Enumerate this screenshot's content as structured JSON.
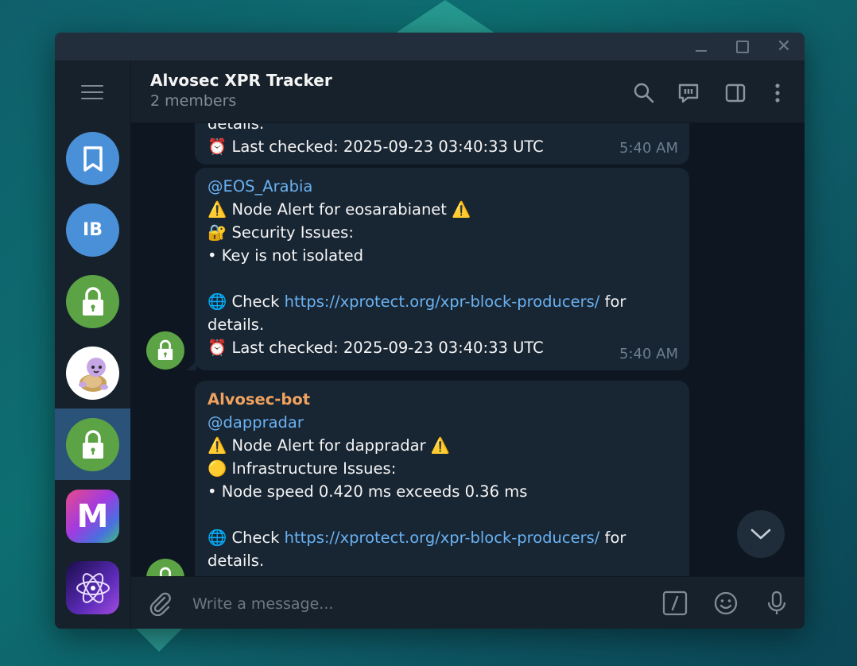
{
  "window": {
    "minimize": "–",
    "maximize": "",
    "close": "✕"
  },
  "sidebar": {
    "menu_icon": "hamburger-icon",
    "chats": [
      {
        "name": "saved-messages",
        "icon": "bookmark-icon",
        "color": "#4a90d9"
      },
      {
        "name": "ib",
        "initials": "IB",
        "color": "#4a90d9"
      },
      {
        "name": "lock-chat-1",
        "icon": "lock-icon",
        "color": "#5ba345"
      },
      {
        "name": "turtle-chat",
        "icon": "turtle-icon",
        "color": "#ffffff"
      },
      {
        "name": "lock-chat-selected",
        "icon": "lock-icon",
        "color": "#5ba345",
        "selected": true
      },
      {
        "name": "m-chat",
        "initials": "M",
        "color": "#c03bd8"
      },
      {
        "name": "atom-chat",
        "icon": "atom-icon",
        "color": "#3b1c8a"
      }
    ]
  },
  "header": {
    "title": "Alvosec XPR Tracker",
    "subtitle": "2 members",
    "icons": [
      "search-icon",
      "topics-icon",
      "side-panel-icon",
      "more-icon"
    ]
  },
  "messages": [
    {
      "partial_top": "details.",
      "last_checked": "⏰ Last checked: 2025-09-23 03:40:33 UTC",
      "time": "5:40 AM"
    },
    {
      "mention": "@EOS_Arabia",
      "alert": "⚠️ Node Alert for eosarabianet ⚠️",
      "issue_title": "🔐 Security Issues:",
      "issue_item": " • Key is not isolated",
      "check_prefix": "🌐 Check ",
      "link": "https://xprotect.org/xpr-block-producers/",
      "check_suffix": " for",
      "details": "details.",
      "last_checked": "⏰ Last checked: 2025-09-23 03:40:33 UTC",
      "time": "5:40 AM"
    },
    {
      "sender": "Alvosec-bot",
      "mention": "@dappradar",
      "alert": "⚠️ Node Alert for dappradar ⚠️",
      "issue_title": "🟡 Infrastructure Issues:",
      "issue_item": " • Node speed 0.420 ms exceeds 0.36 ms",
      "check_prefix": "🌐 Check ",
      "link": "https://xprotect.org/xpr-block-producers/",
      "check_suffix": " for",
      "details": "details."
    }
  ],
  "composer": {
    "placeholder": "Write a message...",
    "icons": [
      "attach-icon",
      "commands-icon",
      "emoji-icon",
      "microphone-icon"
    ]
  },
  "colors": {
    "accent": "#6ab2f2",
    "sender": "#f0a35e",
    "bubble": "#182533",
    "chat_bg": "#0e1621",
    "panel": "#17212b",
    "selected": "#2b5278"
  }
}
